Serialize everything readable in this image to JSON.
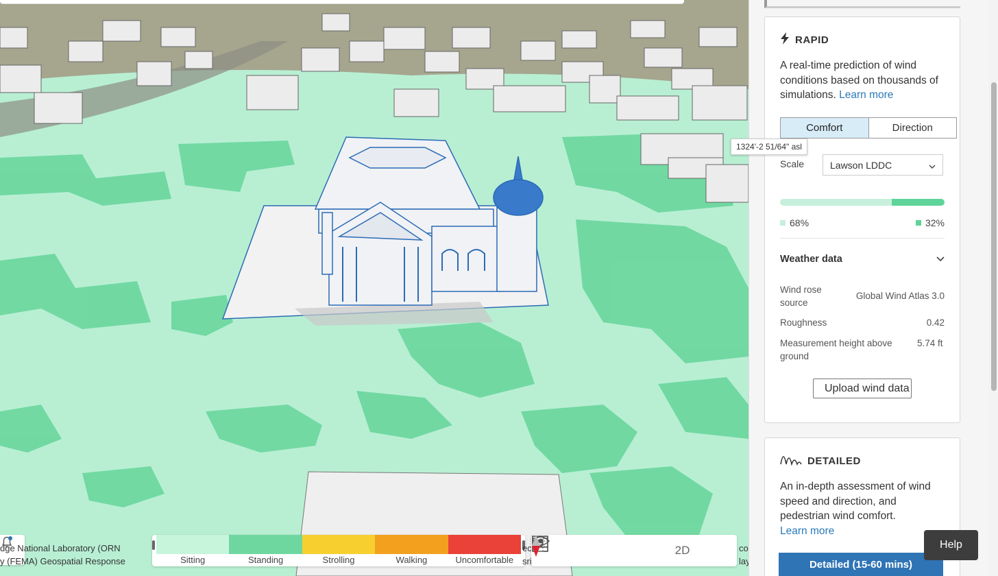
{
  "map": {
    "elevation_tooltip": "1324'-2 51/64\" asl",
    "attribution_left_line1": "dge National Laboratory (ORN",
    "attribution_left_line2": "y (FEMA) Geospatial Response",
    "attribution_mid_line1": "ec",
    "attribution_mid_line2": "sri",
    "attribution_right_line1": "contributors, Microsoft, Esri Community M",
    "attribution_right_line2": "layer by Esri. Powered by Esri."
  },
  "legend": {
    "items": [
      {
        "label": "Sitting",
        "color": "#c6f5dc"
      },
      {
        "label": "Standing",
        "color": "#6ed7a0"
      },
      {
        "label": "Strolling",
        "color": "#f7cf2f"
      },
      {
        "label": "Walking",
        "color": "#f2a01e"
      },
      {
        "label": "Uncomfortable",
        "color": "#ea4138"
      }
    ]
  },
  "toolbar": {
    "tools": [
      "grid-icon",
      "eye-icon",
      "camera-icon",
      "focus-icon"
    ],
    "mode_label": "2D"
  },
  "rapid": {
    "title": "RAPID",
    "description": "A real-time prediction of wind conditions based on thousands of simulations.",
    "learn_more": "Learn more",
    "tabs": [
      "Comfort",
      "Direction"
    ],
    "active_tab": "Comfort",
    "scale_label": "Scale",
    "scale_value": "Lawson LDDC",
    "left_pct": "68%",
    "right_pct": "32%",
    "left_fraction": 0.68,
    "left_color": "#c6f0dc",
    "right_color": "#5fd49a",
    "weather_title": "Weather data",
    "wind_rose_label": "Wind rose source",
    "wind_rose_value": "Global Wind Atlas 3.0",
    "roughness_label": "Roughness",
    "roughness_value": "0.42",
    "height_label": "Measurement height above ground",
    "height_value": "5.74 ft",
    "upload_label": "Upload wind data"
  },
  "detailed": {
    "title": "DETAILED",
    "description": "An in-depth assessment of wind speed and direction, and pedestrian wind comfort.",
    "learn_more": "Learn more",
    "bottom_button": "Detailed (15-60 mins)"
  },
  "help_label": "Help",
  "colors": {
    "accent": "#2a7ab8",
    "ground": "#b8efd3",
    "wind_patch": "#6ed7a0",
    "building_outline": "#2b6bb5"
  }
}
